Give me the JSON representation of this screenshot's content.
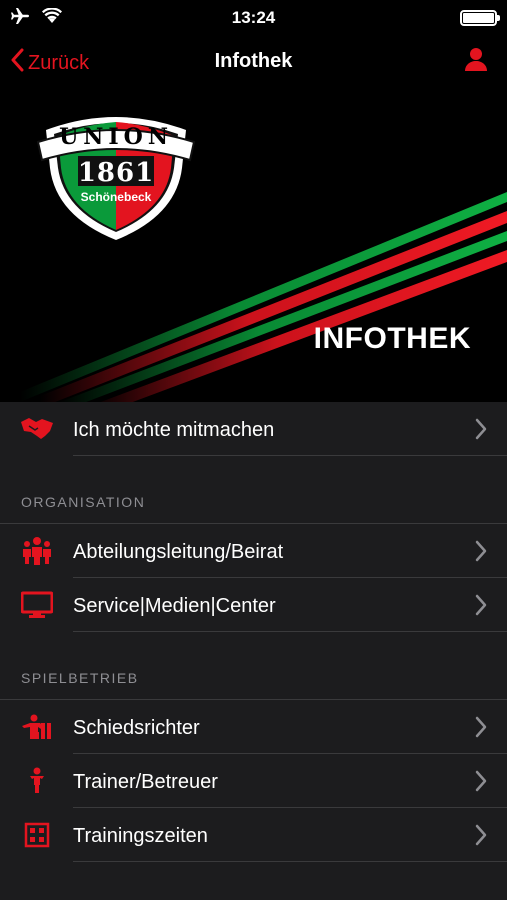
{
  "status_bar": {
    "time": "13:24"
  },
  "nav": {
    "back_label": "Zurück",
    "title": "Infothek",
    "user_icon": "user-icon"
  },
  "hero": {
    "title": "INFOTHEK",
    "logo": {
      "top_text": "UNION",
      "year": "1861",
      "city": "Schönebeck"
    }
  },
  "top_item": {
    "label": "Ich möchte mitmachen",
    "icon": "handshake-icon"
  },
  "sections": [
    {
      "header": "ORGANISATION",
      "items": [
        {
          "label": "Abteilungsleitung/Beirat",
          "icon": "people-icon"
        },
        {
          "label": "Service|Medien|Center",
          "icon": "monitor-icon"
        }
      ]
    },
    {
      "header": "SPIELBETRIEB",
      "items": [
        {
          "label": "Schiedsrichter",
          "icon": "referee-icon"
        },
        {
          "label": "Trainer/Betreuer",
          "icon": "trainer-icon"
        },
        {
          "label": "Trainingszeiten",
          "icon": "schedule-icon"
        }
      ]
    }
  ],
  "colors": {
    "accent": "#e3141f",
    "green": "#0a9a3a",
    "background": "#1c1c1e",
    "separator": "#3a3a3c"
  }
}
